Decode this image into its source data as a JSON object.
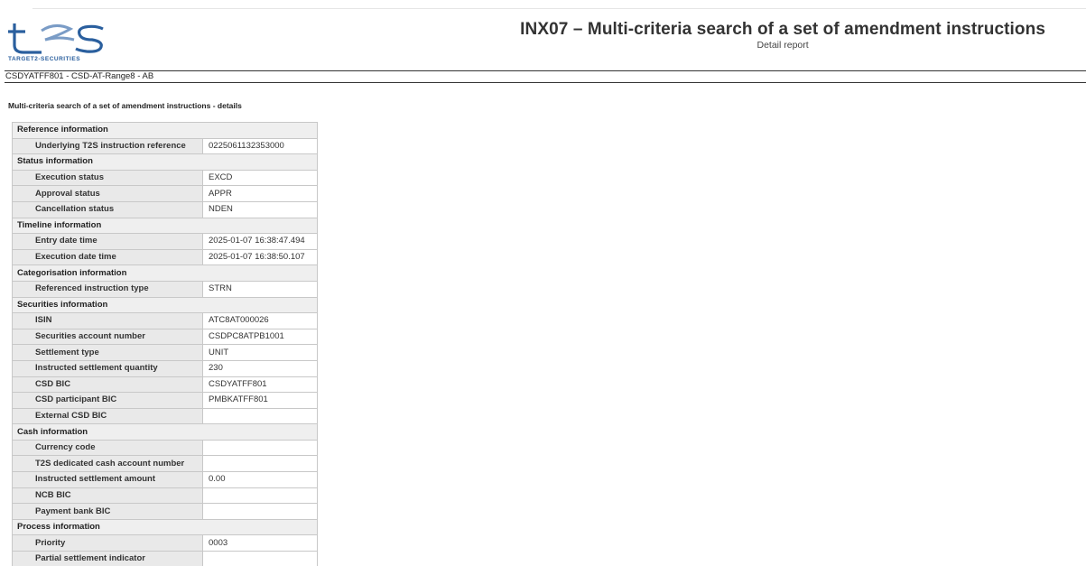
{
  "header": {
    "logo_text": "TARGET2-SECURITIES",
    "title": "INX07 – Multi-criteria search of a set of amendment instructions",
    "subtitle": "Detail report",
    "context": "CSDYATFF801 - CSD-AT-Range8 - AB"
  },
  "section_title": "Multi-criteria search of a set of amendment instructions - details",
  "colors": {
    "brand_blue": "#2a5f9e",
    "group_bg": "#efefef",
    "label_bg": "#e9e9e9",
    "border": "#c8c8c8"
  },
  "groups": [
    {
      "title": "Reference information",
      "rows": [
        {
          "label": "Underlying T2S instruction reference",
          "value": "0225061132353000"
        }
      ]
    },
    {
      "title": "Status information",
      "rows": [
        {
          "label": "Execution status",
          "value": "EXCD"
        },
        {
          "label": "Approval status",
          "value": "APPR"
        },
        {
          "label": "Cancellation status",
          "value": "NDEN"
        }
      ]
    },
    {
      "title": "Timeline information",
      "rows": [
        {
          "label": "Entry date time",
          "value": "2025-01-07 16:38:47.494"
        },
        {
          "label": "Execution date time",
          "value": "2025-01-07 16:38:50.107"
        }
      ]
    },
    {
      "title": "Categorisation information",
      "rows": [
        {
          "label": "Referenced instruction type",
          "value": "STRN"
        }
      ]
    },
    {
      "title": "Securities information",
      "rows": [
        {
          "label": "ISIN",
          "value": "ATC8AT000026"
        },
        {
          "label": "Securities account number",
          "value": "CSDPC8ATPB1001"
        },
        {
          "label": "Settlement type",
          "value": "UNIT"
        },
        {
          "label": "Instructed settlement quantity",
          "value": "230"
        },
        {
          "label": "CSD BIC",
          "value": "CSDYATFF801"
        },
        {
          "label": "CSD participant BIC",
          "value": "PMBKATFF801"
        },
        {
          "label": "External CSD BIC",
          "value": ""
        }
      ]
    },
    {
      "title": "Cash information",
      "rows": [
        {
          "label": "Currency code",
          "value": ""
        },
        {
          "label": "T2S dedicated cash account number",
          "value": ""
        },
        {
          "label": "Instructed settlement amount",
          "value": "0.00"
        },
        {
          "label": "NCB BIC",
          "value": ""
        },
        {
          "label": "Payment bank BIC",
          "value": ""
        }
      ]
    },
    {
      "title": "Process information",
      "rows": [
        {
          "label": "Priority",
          "value": "0003"
        },
        {
          "label": "Partial settlement indicator",
          "value": ""
        }
      ]
    }
  ]
}
